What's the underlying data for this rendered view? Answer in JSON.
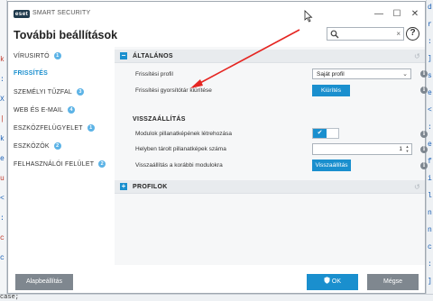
{
  "background": {
    "left_glyphs": [
      "k",
      ":",
      "X",
      "|",
      "k",
      "e",
      "u",
      "<",
      ":",
      "c",
      "c"
    ],
    "right_glyphs": [
      "d",
      "r",
      ":",
      "]",
      "s",
      "e",
      "<",
      ":",
      "e",
      "f",
      "i",
      "l",
      "n",
      "n",
      "c",
      ":",
      "]"
    ],
    "bottom_text": "case;"
  },
  "window": {
    "logo_text": "eset",
    "app_title": "SMART SECURITY",
    "page_title": "További beállítások",
    "minimize_glyph": "—",
    "maximize_glyph": "☐",
    "close_glyph": "✕",
    "help_glyph": "?",
    "search": {
      "placeholder": "",
      "value": "",
      "clear_glyph": "×"
    }
  },
  "sidebar": {
    "items": [
      {
        "label": "VÍRUSIRTÓ",
        "badge": "1",
        "active": false
      },
      {
        "label": "FRISSÍTÉS",
        "badge": "",
        "active": true
      },
      {
        "label": "SZEMÉLYI TŰZFAL",
        "badge": "3",
        "active": false
      },
      {
        "label": "WEB ÉS E-MAIL",
        "badge": "4",
        "active": false
      },
      {
        "label": "ESZKÖZFELÜGYELET",
        "badge": "1",
        "active": false
      },
      {
        "label": "ESZKÖZÖK",
        "badge": "2",
        "active": false
      },
      {
        "label": "FELHASZNÁLÓI FELÜLET",
        "badge": "2",
        "active": false
      }
    ]
  },
  "content": {
    "general": {
      "expander": "−",
      "title": "ÁLTALÁNOS",
      "rows": {
        "update_profile": {
          "label": "Frissítési profil",
          "value": "Saját profil"
        },
        "clear_cache": {
          "label": "Frissítési gyorsítótár kiürítése",
          "button": "Kiürítés"
        }
      }
    },
    "rollback": {
      "title": "VISSZAÁLLÍTÁS",
      "rows": {
        "snapshots": {
          "label": "Modulok pillanatképének létrehozása",
          "enabled": true,
          "check_glyph": "✔"
        },
        "snapshot_count": {
          "label": "Helyben tárolt pillanatképek száma",
          "value": "1"
        },
        "revert": {
          "label": "Visszaállítás a korábbi modulokra",
          "button": "Visszaállítás"
        }
      }
    },
    "profiles": {
      "expander": "+",
      "title": "PROFILOK"
    },
    "info_glyph": "i",
    "reset_glyph": "↺"
  },
  "footer": {
    "defaults": "Alapbeállítás",
    "ok": "OK",
    "ok_icon": "shield-icon",
    "cancel": "Mégse"
  },
  "colors": {
    "accent": "#1a8fce",
    "arrow": "#e52521",
    "gray_button": "#7f878f"
  }
}
